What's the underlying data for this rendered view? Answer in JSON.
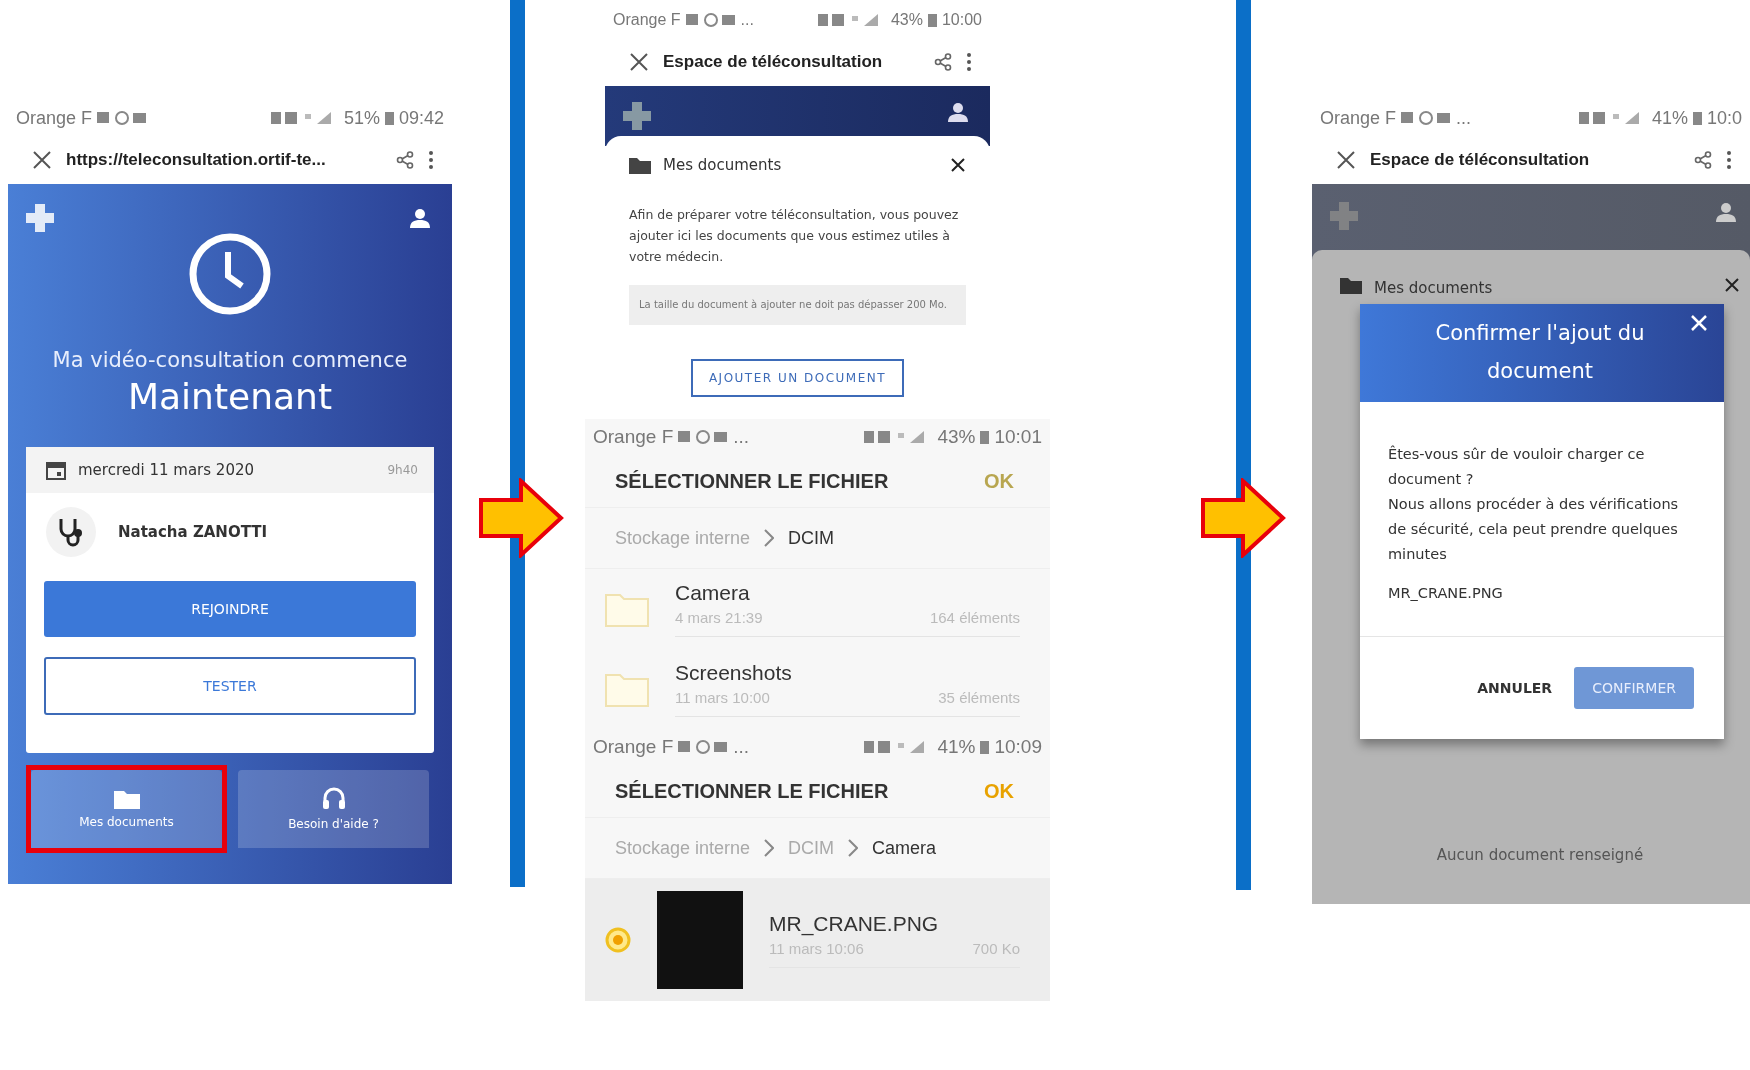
{
  "home_screen": {
    "status": {
      "carrier": "Orange F",
      "battery": "51%",
      "time": "09:42"
    },
    "browser": {
      "title": "https://teleconsultation.ortif-te..."
    },
    "heading": "Ma vidéo-consultation commence",
    "headline": "Maintenant",
    "appointment": {
      "date": "mercredi 11 mars 2020",
      "time": "9h40",
      "doctor": "Natacha ZANOTTI"
    },
    "buttons": [
      {
        "label": "REJOINDRE",
        "kind": "primary"
      },
      {
        "label": "TESTER",
        "kind": "outline"
      }
    ],
    "bottom_tabs": [
      {
        "label": "Mes documents",
        "kind": "folder",
        "highlighted": true
      },
      {
        "label": "Besoin d'aide ?",
        "kind": "headset",
        "highlighted": false
      }
    ]
  },
  "documents_screen": {
    "status": {
      "carrier": "Orange F",
      "more": "...",
      "battery": "43%",
      "time": "10:00"
    },
    "browser": {
      "title": "Espace de téléconsultation"
    },
    "sheet": {
      "title": "Mes documents",
      "description": "Afin de préparer votre téléconsultation, vous pouvez ajouter ici les documents que vous estimez utiles à votre médecin.",
      "note": "La taille du document à ajouter ne doit pas dépasser 200 Mo.",
      "button": "AJOUTER UN DOCUMENT"
    }
  },
  "file_pickers": [
    {
      "status": {
        "carrier": "Orange F",
        "more": "...",
        "battery": "43%",
        "time": "10:01"
      },
      "title": "SÉLECTIONNER LE FICHIER",
      "ok": {
        "label": "OK",
        "enabled": false
      },
      "breadcrumbs": [
        "Stockage interne",
        "DCIM"
      ],
      "items": [
        {
          "kind": "folder",
          "name": "Camera",
          "date": "4 mars 21:39",
          "info": "164 éléments"
        },
        {
          "kind": "folder",
          "name": "Screenshots",
          "date": "11 mars 10:00",
          "info": "35 éléments"
        }
      ]
    },
    {
      "status": {
        "carrier": "Orange F",
        "more": "...",
        "battery": "41%",
        "time": "10:09"
      },
      "title": "SÉLECTIONNER LE FICHIER",
      "ok": {
        "label": "OK",
        "enabled": true
      },
      "breadcrumbs": [
        "Stockage interne",
        "DCIM",
        "Camera"
      ],
      "items": [
        {
          "kind": "file",
          "name": "MR_CRANE.PNG",
          "date": "11 mars 10:06",
          "info": "700 Ko",
          "selected": true
        }
      ]
    }
  ],
  "confirm_screen": {
    "status": {
      "carrier": "Orange F",
      "more": "...",
      "battery": "41%",
      "time": "10:0"
    },
    "browser": {
      "title": "Espace de téléconsultation"
    },
    "background_title": "Mes documents",
    "dialog": {
      "title": "Confirmer l'ajout du document",
      "lines": [
        "Êtes-vous sûr de vouloir charger ce document ?",
        "Nous allons procéder à des vérifications de sécurité, cela peut prendre quelques minutes"
      ],
      "filename": "MR_CRANE.PNG",
      "cancel": "ANNULER",
      "confirm": "CONFIRMER"
    },
    "empty_text": "Aucun document renseigné"
  }
}
